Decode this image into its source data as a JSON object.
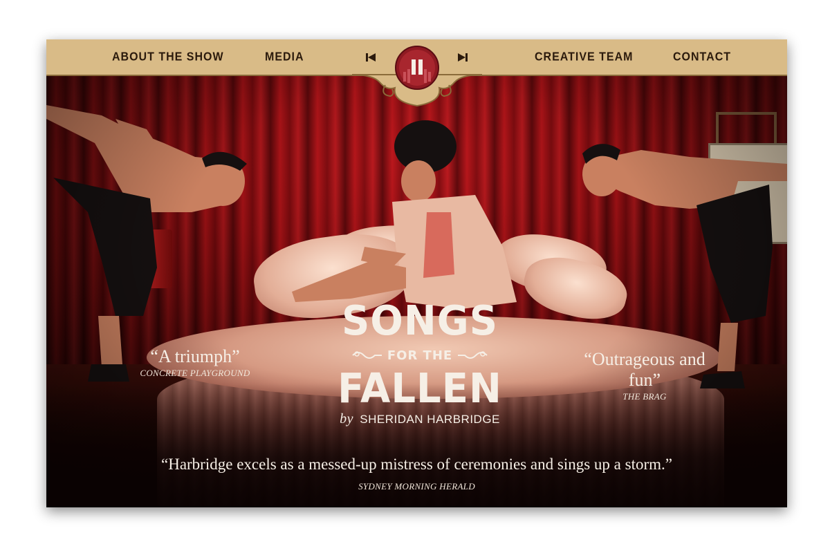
{
  "nav": {
    "about_label": "ABOUT THE SHOW",
    "media_label": "MEDIA",
    "team_label": "CREATIVE TEAM",
    "contact_label": "CONTACT",
    "player": {
      "prev_icon": "skip-previous-icon",
      "play_icon": "pause-icon",
      "next_icon": "skip-next-icon",
      "state": "playing"
    }
  },
  "hero": {
    "title_line1": "SONGS",
    "title_line2": "FOR THE",
    "title_line3": "FALLEN",
    "byline_by": "by",
    "byline_name": "SHERIDAN HARBRIDGE"
  },
  "quotes": {
    "left": {
      "text": "“A triumph”",
      "source": "CONCRETE PLAYGROUND"
    },
    "right": {
      "text": "“Outrageous and fun”",
      "source": "THE BRAG"
    },
    "bottom": {
      "text": "“Harbridge excels as a messed-up mistress of ceremonies and sings up a storm.”",
      "source": "SYDNEY MORNING HERALD"
    }
  },
  "colors": {
    "nav_bg": "#d9bb87",
    "nav_text": "#2b1a0c",
    "accent_red": "#9a1a22",
    "curtain": "#8e0c10",
    "text_light": "#f6efe6"
  }
}
